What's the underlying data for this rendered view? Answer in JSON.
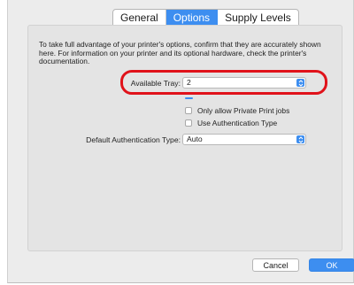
{
  "tabs": [
    {
      "label": "General",
      "active": false
    },
    {
      "label": "Options",
      "active": true
    },
    {
      "label": "Supply Levels",
      "active": false
    }
  ],
  "description": "To take full advantage of your printer's options, confirm that they are accurately shown here. For information on your printer and its optional hardware, check the printer's documentation.",
  "available_tray": {
    "label": "Available Tray:",
    "value": "2"
  },
  "checkboxes": [
    {
      "label": "Only allow Private Print jobs",
      "checked": false
    },
    {
      "label": "Use Authentication Type",
      "checked": false
    }
  ],
  "default_auth": {
    "label": "Default Authentication Type:",
    "value": "Auto"
  },
  "buttons": {
    "cancel": "Cancel",
    "ok": "OK"
  },
  "colors": {
    "accent": "#3d8ef0",
    "highlight": "#e0121a"
  }
}
